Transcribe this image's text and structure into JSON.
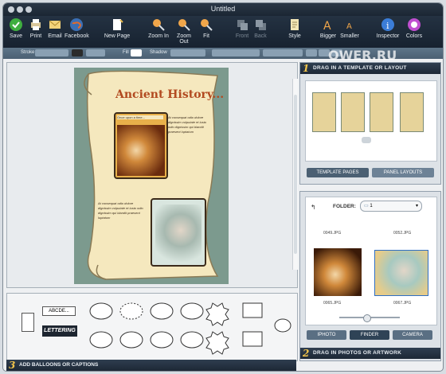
{
  "window": {
    "title": "Untitled"
  },
  "toolbar": {
    "save": "Save",
    "print": "Print",
    "email": "Email",
    "facebook": "Facebook",
    "new_page": "New Page",
    "zoom_in": "Zoom In",
    "zoom_out": "Zoom Out",
    "fit": "Fit",
    "front": "Front",
    "back": "Back",
    "style": "Style",
    "bigger": "Bigger",
    "smaller": "Smaller",
    "inspector": "Inspector",
    "colors": "Colors"
  },
  "format_bar": {
    "stroke": "Stroke",
    "fill": "Fill",
    "shadow": "Shadow"
  },
  "page": {
    "headline": "Ancient History...",
    "caption_top": "Once upon a time...",
    "body_text": "At consequat odio dolore dignissim vulputate et iusto odio dignissim qui blandit praesent luptatum"
  },
  "templates_panel": {
    "number": "1",
    "title": "DRAG IN A TEMPLATE OR LAYOUT",
    "tab_templates": "TEMPLATE PAGES",
    "tab_layouts": "PANEL LAYOUTS"
  },
  "photos_panel": {
    "number": "2",
    "title": "DRAG IN PHOTOS OR ARTWORK",
    "folder_label": "FOLDER:",
    "folder_value": "1",
    "files": [
      "0049.JPG",
      "0052.JPG",
      "0065.JPG",
      "0067.JPG"
    ],
    "tab_iphoto": "IPHOTO",
    "tab_finder": "FINDER",
    "tab_camera": "CAMERA"
  },
  "balloons_panel": {
    "number": "3",
    "title": "ADD BALLOONS OR CAPTIONS",
    "abcde": "ABCDE...",
    "lettering": "LETTERING"
  },
  "watermark": "OWER.RU"
}
